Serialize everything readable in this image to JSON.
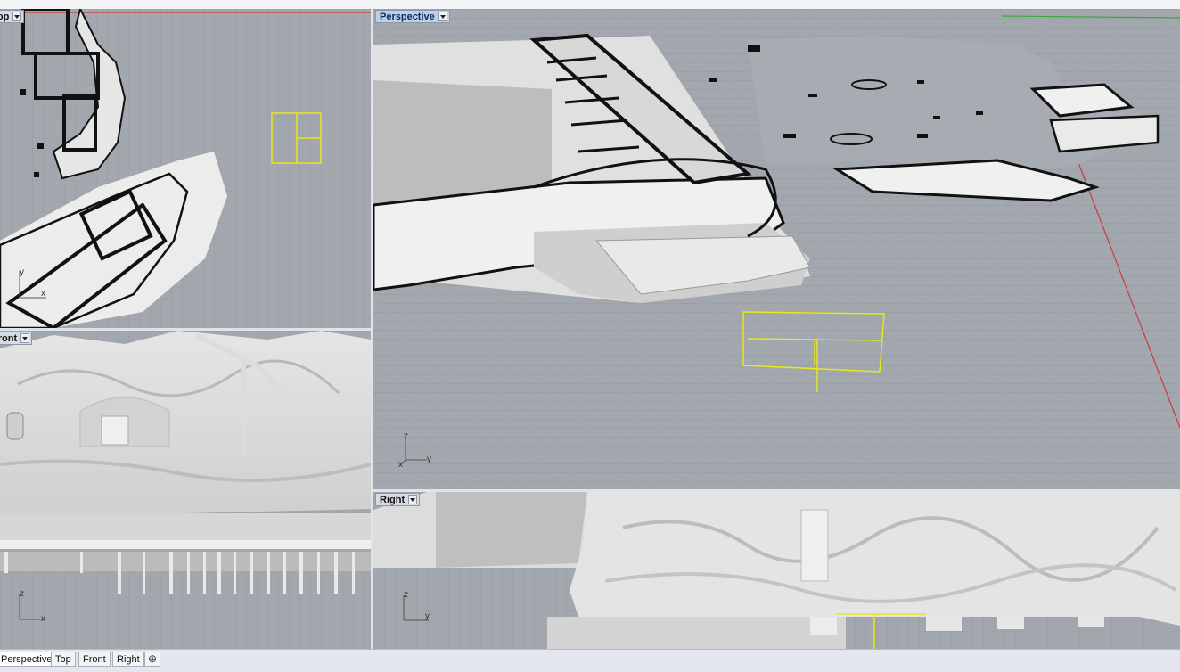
{
  "viewports": {
    "top": {
      "label": "Top"
    },
    "front": {
      "label": "Front"
    },
    "perspective": {
      "label": "Perspective"
    },
    "right": {
      "label": "Right"
    }
  },
  "axes": {
    "top": {
      "v": "y",
      "h": "x"
    },
    "front": {
      "v": "z",
      "h": "x"
    },
    "perspective": {
      "v": "z",
      "h": "y",
      "d": "x"
    },
    "right": {
      "v": "z",
      "h": "y"
    }
  },
  "tabs": [
    "Perspective",
    "Top",
    "Front",
    "Right"
  ],
  "add_tab_symbol": "⊕",
  "colors": {
    "viewport_bg": "#a3a8ae",
    "grid": "#8d9299",
    "selection": "#e8e81a",
    "x_axis": "#c83a3a",
    "y_axis": "#3aa83a"
  }
}
